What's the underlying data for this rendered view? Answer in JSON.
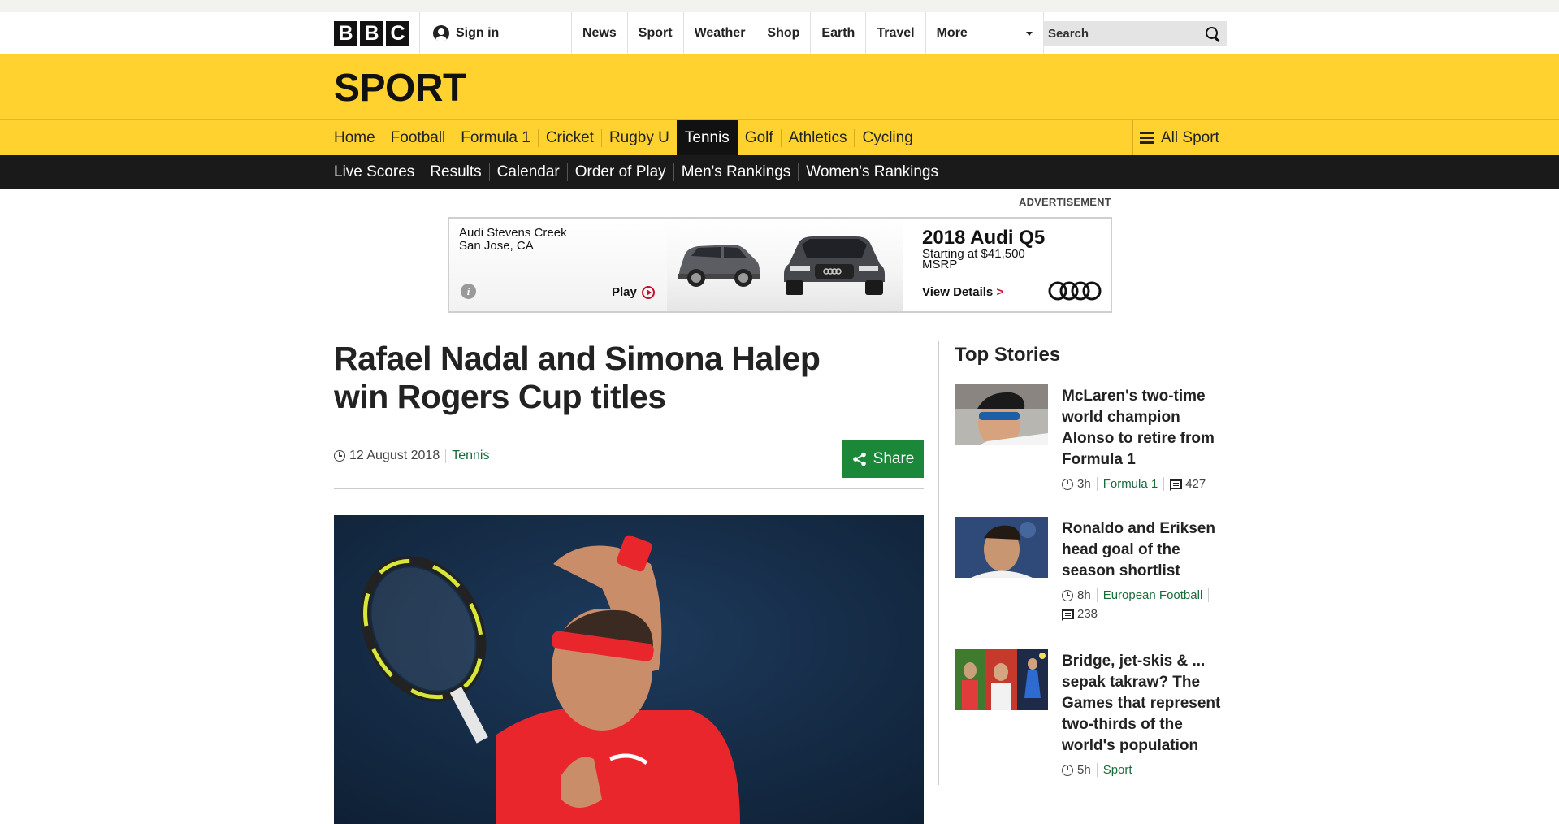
{
  "masthead": {
    "logo_letters": [
      "B",
      "B",
      "C"
    ],
    "signin_label": "Sign in",
    "nav": [
      "News",
      "Sport",
      "Weather",
      "Shop",
      "Earth",
      "Travel"
    ],
    "more_label": "More",
    "search_placeholder": "Search"
  },
  "sport_banner": {
    "title": "SPORT"
  },
  "sport_nav": {
    "items": [
      "Home",
      "Football",
      "Formula 1",
      "Cricket",
      "Rugby U",
      "Tennis",
      "Golf",
      "Athletics",
      "Cycling"
    ],
    "active": "Tennis",
    "all_sport_label": "All Sport"
  },
  "sub_nav": {
    "items": [
      "Live Scores",
      "Results",
      "Calendar",
      "Order of Play",
      "Men's Rankings",
      "Women's Rankings"
    ]
  },
  "advertisement": {
    "label": "ADVERTISEMENT",
    "dealer_line1": "Audi Stevens Creek",
    "dealer_line2": "San Jose, CA",
    "info_glyph": "i",
    "play_label": "Play",
    "model": "2018 Audi Q5",
    "price_line1": "Starting at $41,500",
    "price_line2": "MSRP",
    "details_label": "View Details",
    "details_arrow": ">"
  },
  "article": {
    "headline": "Rafael Nadal and Simona Halep win Rogers Cup titles",
    "date": "12 August 2018",
    "section": "Tennis",
    "share_label": "Share"
  },
  "sidebar": {
    "title": "Top Stories",
    "stories": [
      {
        "title": "McLaren's two-time world champion Alonso to retire from Formula 1",
        "time": "3h",
        "section": "Formula 1",
        "comments": "427"
      },
      {
        "title": "Ronaldo and Eriksen head goal of the season shortlist",
        "time": "8h",
        "section": "European Football",
        "comments": "238"
      },
      {
        "title": "Bridge, jet-skis & ... sepak takraw? The Games that represent two-thirds of the world's population",
        "time": "5h",
        "section": "Sport"
      }
    ]
  },
  "colors": {
    "sport_yellow": "#ffd230",
    "nav_dark": "#1a1a1a",
    "share_green": "#1a8739",
    "link_green": "#1a6b3c",
    "audi_red": "#c8102e"
  },
  "icons": [
    "user-icon",
    "caret-down-icon",
    "search-icon",
    "menu-icon",
    "info-icon",
    "play-icon",
    "audi-logo",
    "clock-icon",
    "share-icon",
    "comment-icon"
  ]
}
